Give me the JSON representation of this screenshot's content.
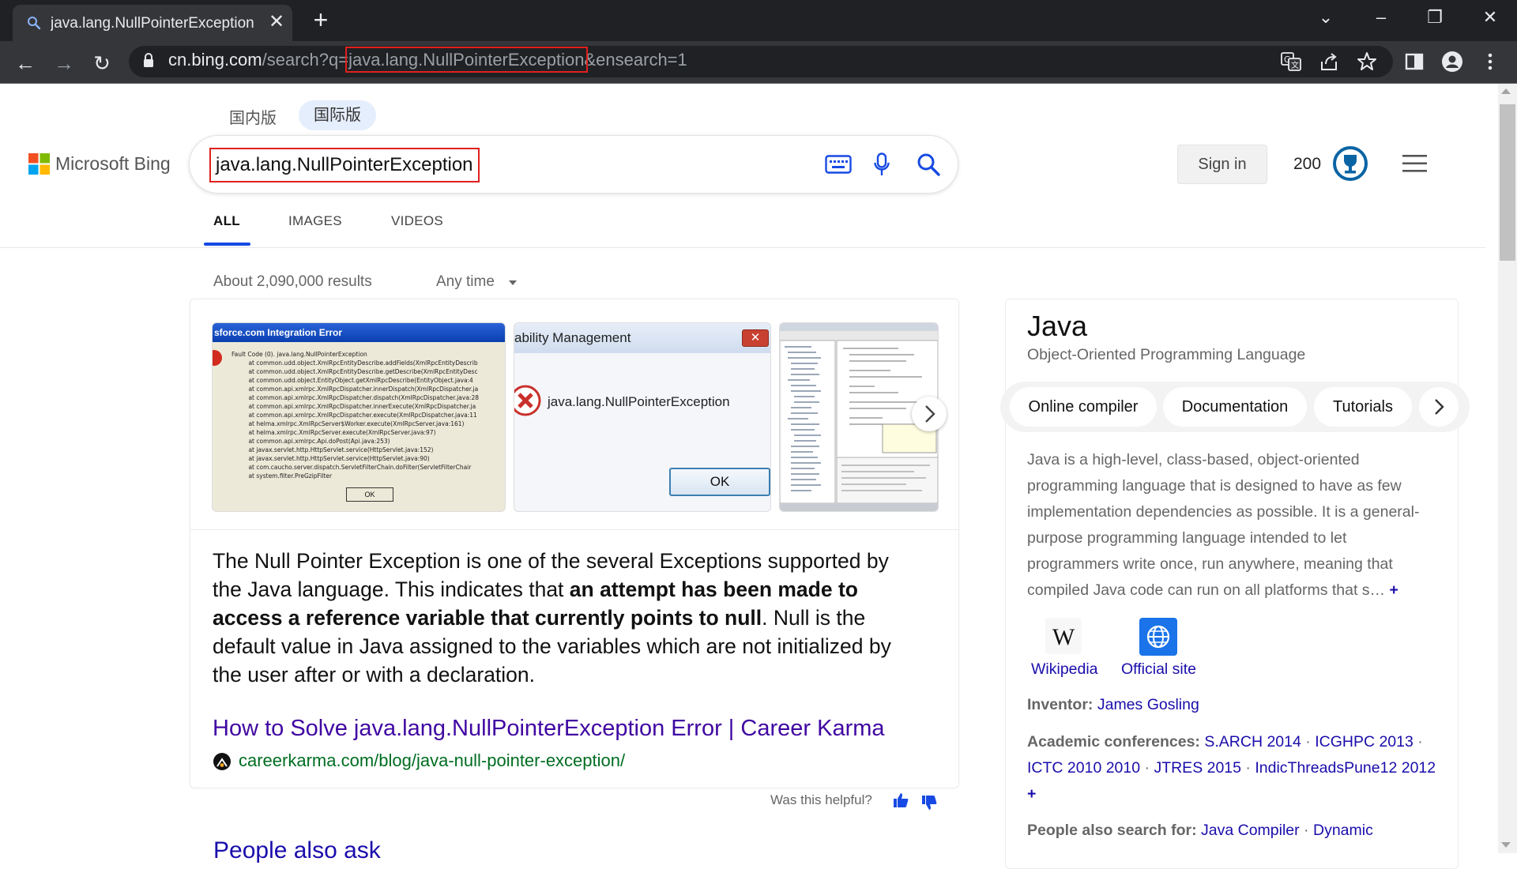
{
  "browser": {
    "tab_title": "java.lang.NullPointerException - Search",
    "tab_close": "✕",
    "new_tab": "+",
    "url_host": "cn.bing.com",
    "url_path": "/search?q=",
    "url_query": "java.lang.NullPointerException",
    "url_suffix": "&ensearch=1",
    "window_controls": {
      "tabsearch": "⌄",
      "minimize": "–",
      "restore": "❐",
      "close": "✕"
    },
    "nav": {
      "back": "←",
      "forward": "→",
      "reload": "↻"
    }
  },
  "bing": {
    "logo_text": "Microsoft Bing",
    "market_domestic": "国内版",
    "market_international": "国际版",
    "query": "java.lang.NullPointerException",
    "sign_in": "Sign in",
    "rewards_points": "200",
    "scopes": [
      "ALL",
      "IMAGES",
      "VIDEOS"
    ]
  },
  "results": {
    "count_text": "About 2,090,000 results",
    "time_filter": "Any time",
    "thumb1": {
      "title": "sforce.com Integration Error",
      "body": "Fault Code (0). java.lang.NullPointerException\n         at common.udd.object.XmlRpcEntityDescribe.addFields(XmlRpcEntityDescrib\n         at common.udd.object.XmlRpcEntityDescribe.getDescribe(XmlRpcEntityDesc\n         at common.udd.object.EntityObject.getXmlRpcDescribe(EntityObject.java:4\n         at common.api.xmlrpc.XmlRpcDispatcher.innerDispatch(XmlRpcDispatcher.ja\n         at common.api.xmlrpc.XmlRpcDispatcher.dispatch(XmlRpcDispatcher.java:28\n         at common.api.xmlrpc.XmlRpcDispatcher.innerExecute(XmlRpcDispatcher.ja\n         at common.api.xmlrpc.XmlRpcDispatcher.execute(XmlRpcDispatcher.java:11\n         at helma.xmlrpc.XmlRpcServer$Worker.execute(XmlRpcServer.java:161)\n         at helma.xmlrpc.XmlRpcServer.execute(XmlRpcServer.java:97)\n         at common.api.xmlrpc.Api.doPost(Api.java:253)\n         at javax.servlet.http.HttpServlet.service(HttpServlet.java:152)\n         at javax.servlet.http.HttpServlet.service(HttpServlet.java:90)\n         at com.caucho.server.dispatch.ServletFilterChain.doFilter(ServletFilterChair\n         at system.filter.PreGzipFilter",
      "ok": "OK"
    },
    "thumb2": {
      "title": "ability Management",
      "close": "✕",
      "message": "java.lang.NullPointerException",
      "ok": "OK"
    },
    "snippet_p1": "The Null Pointer Exception is one of the several Exceptions supported by the Java language. This indicates that ",
    "snippet_bold": "an attempt has been made to access a reference variable that currently points to null",
    "snippet_p2": ". Null is the default value in Java assigned to the variables which are not initialized by the user after or with a declaration.",
    "link_title": "How to Solve java.lang.NullPointerException Error | Career Karma",
    "link_url": "careerkarma.com/blog/java-null-pointer-exception/",
    "helpful": "Was this helpful?",
    "paa_heading": "People also ask"
  },
  "knowledge_panel": {
    "title": "Java",
    "subtitle": "Object-Oriented Programming Language",
    "chips": [
      "Online compiler",
      "Documentation",
      "Tutorials"
    ],
    "description": "Java is a high-level, class-based, object-oriented programming language that is designed to have as few implementation dependencies as possible. It is a general-purpose programming language intended to let programmers write once, run anywhere, meaning that compiled Java code can run on all platforms that s…",
    "more": "+",
    "wiki_label": "Wikipedia",
    "official_label": "Official site",
    "inventor_key": "Inventor:",
    "inventor": "James Gosling",
    "conferences_key": "Academic conferences:",
    "conferences": [
      "S.ARCH 2014",
      "ICGHPC 2013",
      "ICTC 2010 2010",
      "JTRES 2015",
      "IndicThreadsPune12 2012"
    ],
    "conferences_more": "+",
    "also_key": "People also search for:",
    "also": [
      "Java Compiler",
      "Dynamic"
    ]
  }
}
